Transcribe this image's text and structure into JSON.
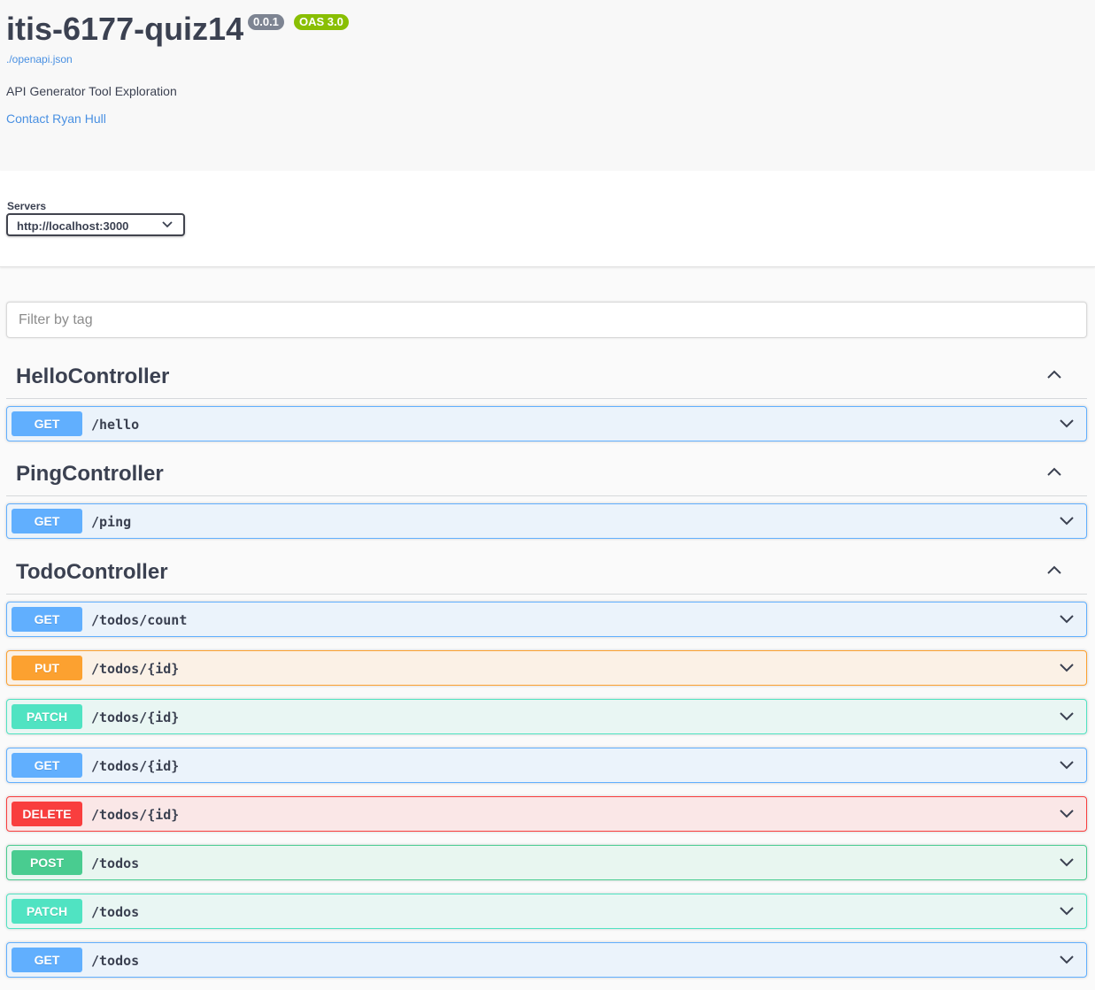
{
  "info": {
    "title": "itis-6177-quiz14",
    "version_badge": "0.0.1",
    "oas_badge": "OAS 3.0",
    "spec_link": "./openapi.json",
    "description": "API Generator Tool Exploration",
    "contact": "Contact Ryan Hull"
  },
  "servers": {
    "label": "Servers",
    "selected": "http://localhost:3000"
  },
  "filter": {
    "placeholder": "Filter by tag"
  },
  "colors": {
    "get": "#61affe",
    "put": "#fca130",
    "patch": "#50e3c2",
    "delete": "#f93e3e",
    "post": "#49cc90",
    "link": "#4990e2"
  },
  "tags": [
    {
      "name": "HelloController",
      "expanded": true,
      "operations": [
        {
          "method": "GET",
          "path": "/hello"
        }
      ]
    },
    {
      "name": "PingController",
      "expanded": true,
      "operations": [
        {
          "method": "GET",
          "path": "/ping"
        }
      ]
    },
    {
      "name": "TodoController",
      "expanded": true,
      "operations": [
        {
          "method": "GET",
          "path": "/todos/count"
        },
        {
          "method": "PUT",
          "path": "/todos/{id}"
        },
        {
          "method": "PATCH",
          "path": "/todos/{id}"
        },
        {
          "method": "GET",
          "path": "/todos/{id}"
        },
        {
          "method": "DELETE",
          "path": "/todos/{id}"
        },
        {
          "method": "POST",
          "path": "/todos"
        },
        {
          "method": "PATCH",
          "path": "/todos"
        },
        {
          "method": "GET",
          "path": "/todos"
        }
      ]
    }
  ]
}
